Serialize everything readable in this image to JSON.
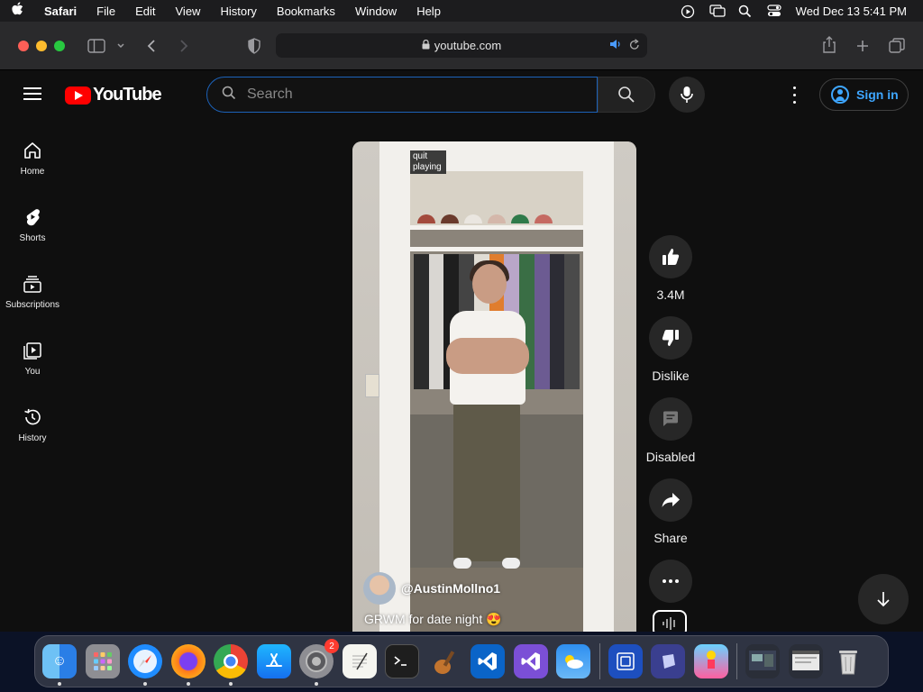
{
  "menubar": {
    "app": "Safari",
    "menus": [
      "File",
      "Edit",
      "View",
      "History",
      "Bookmarks",
      "Window",
      "Help"
    ],
    "clock": "Wed Dec 13  5:41 PM"
  },
  "safari": {
    "url": "youtube.com"
  },
  "youtube": {
    "logo_text": "YouTube",
    "search_placeholder": "Search",
    "sign_in": "Sign in",
    "sidebar": [
      {
        "label": "Home",
        "icon": "home-icon"
      },
      {
        "label": "Shorts",
        "icon": "shorts-icon"
      },
      {
        "label": "Subscriptions",
        "icon": "subscriptions-icon"
      },
      {
        "label": "You",
        "icon": "you-icon"
      },
      {
        "label": "History",
        "icon": "history-icon"
      }
    ],
    "short": {
      "tooltip": "quit playing",
      "channel": "@AustinMollno1",
      "caption": "GRWM for date night 😍"
    },
    "actions": {
      "like_count": "3.4M",
      "dislike": "Dislike",
      "comments": "Disabled",
      "share": "Share"
    }
  },
  "dock": {
    "apps": [
      "Finder",
      "Launchpad",
      "Safari",
      "Firefox",
      "Chrome",
      "App Store",
      "System Settings",
      "TextEdit",
      "Terminal",
      "Instruments",
      "VS Code",
      "Visual Studio",
      "Weather",
      "Screen Sharing",
      "Xcode Previews",
      "Game",
      "Window 1",
      "Window 2",
      "Trash"
    ],
    "settings_badge": "2"
  },
  "colors": {
    "yt_background": "#0f0f0f",
    "yt_red": "#ff0000",
    "link_blue": "#3ea6ff"
  }
}
